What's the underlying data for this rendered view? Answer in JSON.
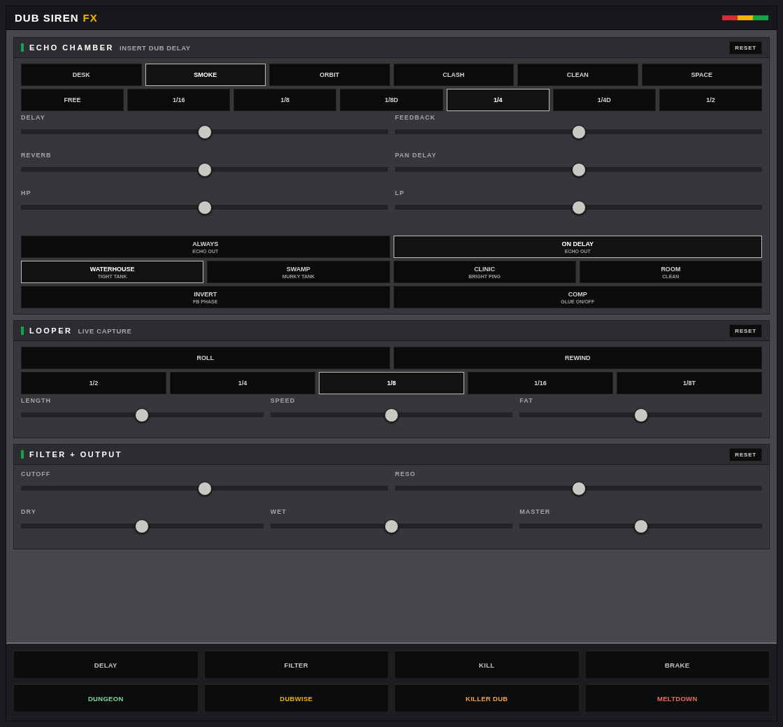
{
  "header": {
    "title": "DUB SIREN",
    "title_accent": "FX"
  },
  "sections": [
    {
      "title": "ECHO CHAMBER",
      "subtitle": "INSERT DUB DELAY",
      "reset": "RESET",
      "rows": [
        {
          "kind": "buttons",
          "items": [
            {
              "label": "DESK",
              "selected": false
            },
            {
              "label": "SMOKE",
              "selected": true
            },
            {
              "label": "ORBIT",
              "selected": false
            },
            {
              "label": "CLASH",
              "selected": false
            },
            {
              "label": "CLEAN",
              "selected": false
            },
            {
              "label": "SPACE",
              "selected": false
            }
          ]
        },
        {
          "kind": "buttons",
          "items": [
            {
              "label": "FREE",
              "selected": false
            },
            {
              "label": "1/16",
              "selected": false
            },
            {
              "label": "1/8",
              "selected": false
            },
            {
              "label": "1/8D",
              "selected": false
            },
            {
              "label": "1/4",
              "selected": true
            },
            {
              "label": "1/4D",
              "selected": false
            },
            {
              "label": "1/2",
              "selected": false
            }
          ]
        },
        {
          "kind": "sliders",
          "items": [
            {
              "label": "DELAY",
              "level": 0.5
            },
            {
              "label": "FEEDBACK",
              "level": 0.5
            }
          ]
        },
        {
          "kind": "sliders",
          "items": [
            {
              "label": "REVERB",
              "level": 0.5
            },
            {
              "label": "PAN DELAY",
              "level": 0.5
            }
          ]
        },
        {
          "kind": "sliders",
          "items": [
            {
              "label": "HP",
              "level": 0.5
            },
            {
              "label": "LP",
              "level": 0.5
            }
          ]
        },
        {
          "kind": "spacer"
        },
        {
          "kind": "buttons",
          "items": [
            {
              "label": "ALWAYS",
              "sublabel": "ECHO OUT",
              "selected": false
            },
            {
              "label": "ON DELAY",
              "sublabel": "ECHO OUT",
              "selected": true
            }
          ]
        },
        {
          "kind": "buttons",
          "items": [
            {
              "label": "WATERHOUSE",
              "sublabel": "TIGHT TANK",
              "selected": true
            },
            {
              "label": "SWAMP",
              "sublabel": "MURKY TANK",
              "selected": false
            },
            {
              "label": "CLINIC",
              "sublabel": "BRIGHT PING",
              "selected": false
            },
            {
              "label": "ROOM",
              "sublabel": "CLEAN",
              "selected": false
            }
          ]
        },
        {
          "kind": "buttons",
          "items": [
            {
              "label": "INVERT",
              "sublabel": "FB PHASE",
              "selected": false
            },
            {
              "label": "COMP",
              "sublabel": "GLUE ON/OFF",
              "selected": false
            }
          ]
        }
      ]
    },
    {
      "title": "LOOPER",
      "subtitle": "LIVE CAPTURE",
      "reset": "RESET",
      "rows": [
        {
          "kind": "buttons",
          "items": [
            {
              "label": "ROLL",
              "selected": false
            },
            {
              "label": "REWIND",
              "selected": false
            }
          ]
        },
        {
          "kind": "buttons",
          "items": [
            {
              "label": "1/2",
              "selected": false
            },
            {
              "label": "1/4",
              "selected": false
            },
            {
              "label": "1/8",
              "selected": true
            },
            {
              "label": "1/16",
              "selected": false
            },
            {
              "label": "1/8T",
              "selected": false
            }
          ]
        },
        {
          "kind": "sliders",
          "items": [
            {
              "label": "LENGTH",
              "level": 0.5
            },
            {
              "label": "SPEED",
              "level": 0.5
            },
            {
              "label": "FAT",
              "level": 0.5
            }
          ]
        }
      ]
    },
    {
      "title": "FILTER + OUTPUT",
      "reset": "RESET",
      "rows": [
        {
          "kind": "sliders",
          "items": [
            {
              "label": "CUTOFF",
              "level": 0.5
            },
            {
              "label": "RESO",
              "level": 0.5
            }
          ]
        },
        {
          "kind": "sliders",
          "items": [
            {
              "label": "DRY",
              "level": 0.5
            },
            {
              "label": "WET",
              "level": 0.5
            },
            {
              "label": "MASTER",
              "level": 0.5
            }
          ]
        }
      ]
    }
  ],
  "footer": [
    [
      {
        "label": "DELAY",
        "color": "#c4c4c4"
      },
      {
        "label": "FILTER",
        "color": "#c4c4c4"
      },
      {
        "label": "KILL",
        "color": "#c4c4c4"
      },
      {
        "label": "BRAKE",
        "color": "#c4c4c4"
      }
    ],
    [
      {
        "label": "DUNGEON",
        "color": "#7fd6a4"
      },
      {
        "label": "DUBWISE",
        "color": "#f0b400"
      },
      {
        "label": "KILLER DUB",
        "color": "#f5a04a"
      },
      {
        "label": "MELTDOWN",
        "color": "#f06a6a"
      }
    ]
  ]
}
